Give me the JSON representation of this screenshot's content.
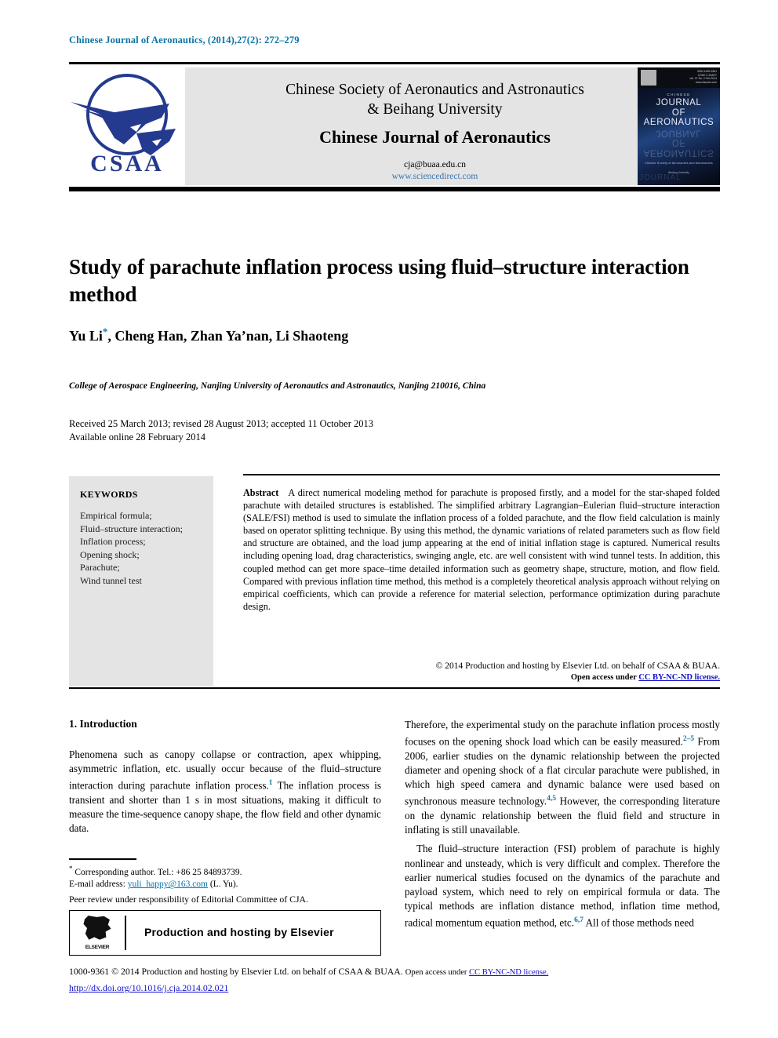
{
  "running_head": "Chinese Journal of Aeronautics, (2014),27(2): 272–279",
  "masthead": {
    "logo_text": "CSAA",
    "society_line1": "Chinese Society of Aeronautics and Astronautics",
    "society_line2": "& Beihang University",
    "journal_title": "Chinese Journal of Aeronautics",
    "email": "cja@buaa.edu.cn",
    "url": "www.sciencedirect.com",
    "cover": {
      "issn_block": "ISSN 1000-9361\nCODE CJOAEY\nVol. 27 No. 2 February 2014\nwww.elsevier.com/locate/cja",
      "chinese_label": "CHINESE",
      "title_line1": "JOURNAL",
      "title_line2": "OF",
      "title_line3": "AERONAUTICS",
      "bottom_line1": "Chinese Society of Aeronautics and Astronautics",
      "bottom_line2": "Beihang University"
    }
  },
  "article": {
    "title": "Study of parachute inflation process using fluid–structure interaction method",
    "authors": "Yu Li , Cheng Han, Zhan Ya’nan, Li Shaoteng",
    "authors_prefix": "Yu Li",
    "corresponding_marker": "*",
    "authors_suffix": ", Cheng Han, Zhan Ya’nan, Li Shaoteng",
    "affiliation": "College of Aerospace Engineering, Nanjing University of Aeronautics and Astronautics, Nanjing 210016, China",
    "received_line": "Received 25 March 2013; revised 28 August 2013; accepted 11 October 2013",
    "available_line": "Available online 28 February 2014"
  },
  "keywords": {
    "heading": "KEYWORDS",
    "items": [
      "Empirical formula;",
      "Fluid–structure interaction;",
      "Inflation process;",
      "Opening shock;",
      "Parachute;",
      "Wind tunnel test"
    ]
  },
  "abstract": {
    "label": "Abstract",
    "text": "A direct numerical modeling method for parachute is proposed firstly, and a model for the star-shaped folded parachute with detailed structures is established. The simplified arbitrary Lagrangian–Eulerian fluid–structure interaction (SALE/FSI) method is used to simulate the inflation process of a folded parachute, and the flow field calculation is mainly based on operator splitting technique. By using this method, the dynamic variations of related parameters such as flow field and structure are obtained, and the load jump appearing at the end of initial inflation stage is captured. Numerical results including opening load, drag characteristics, swinging angle, etc. are well consistent with wind tunnel tests. In addition, this coupled method can get more space–time detailed information such as geometry shape, structure, motion, and flow field. Compared with previous inflation time method, this method is a completely theoretical analysis approach without relying on empirical coefficients, which can provide a reference for material selection, performance optimization during parachute design.",
    "credit": "© 2014 Production and hosting by Elsevier Ltd. on behalf of CSAA & BUAA.",
    "open_access_prefix": "Open access under ",
    "open_access_link": "CC BY-NC-ND license."
  },
  "body": {
    "section1_heading": "1. Introduction",
    "left_paragraphs": [
      {
        "parts": [
          {
            "t": "Phenomena such as canopy collapse or contraction, apex whipping, asymmetric inflation, etc. usually occur because of the fluid–structure interaction during parachute inflation process."
          },
          {
            "sup": "1"
          },
          {
            "t": " The inflation process is transient and shorter than 1 s in most situations, making it difficult to measure the time-sequence canopy shape, the flow field and other dynamic data."
          }
        ]
      }
    ],
    "right_paragraphs": [
      {
        "parts": [
          {
            "t": "Therefore, the experimental study on the parachute inflation process mostly focuses on the opening shock load which can be easily measured."
          },
          {
            "sup": "2–5"
          },
          {
            "t": " From 2006, earlier studies on the dynamic relationship between the projected diameter and opening shock of a flat circular parachute were published, in which high speed camera and dynamic balance were used based on synchronous measure technology."
          },
          {
            "sup": "4,5"
          },
          {
            "t": " However, the corresponding literature on the dynamic relationship between the fluid field and structure in inflating is still unavailable."
          }
        ]
      },
      {
        "indent": true,
        "parts": [
          {
            "t": "The fluid–structure interaction (FSI) problem of parachute is highly nonlinear and unsteady, which is very difficult and complex. Therefore the earlier numerical studies focused on the dynamics of the parachute and payload system, which need to rely on empirical formula or data. The typical methods are inflation distance method, inflation time method, radical momentum equation method, etc."
          },
          {
            "sup": "6,7"
          },
          {
            "t": " All of those methods need"
          }
        ]
      }
    ]
  },
  "footnote": {
    "star": "*",
    "corresponding": "Corresponding author. Tel.: +86 25 84893739.",
    "email_label": "E-mail address:",
    "email": "yuli_happy@163.com",
    "email_suffix": "(L. Yu).",
    "peer_review": "Peer review under responsibility of Editorial Committee of CJA."
  },
  "hosting": {
    "logo_word": "ELSEVIER",
    "text": "Production and hosting by Elsevier"
  },
  "footer": {
    "issn_copyright": "1000-9361 © 2014 Production and hosting by Elsevier Ltd. on behalf of CSAA & BUAA.",
    "open_access_prefix": "Open access under ",
    "open_access_link": "CC BY-NC-ND license.",
    "doi": "http://dx.doi.org/10.1016/j.cja.2014.02.021"
  },
  "colors": {
    "running_head": "#0b74a8",
    "logo_blue": "#243a8f",
    "link_blue": "#1111cc",
    "url_blue": "#3c77b5",
    "ref_teal": "#0b74a8",
    "box_gray": "#e4e4e4"
  }
}
